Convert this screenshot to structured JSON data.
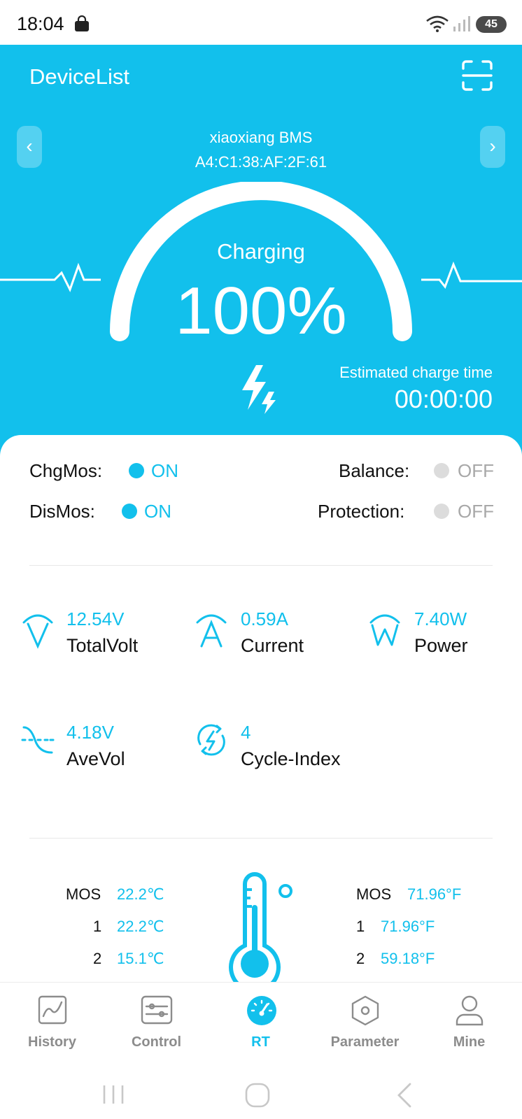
{
  "status_bar": {
    "time": "18:04",
    "battery": "45"
  },
  "header": {
    "title": "DeviceList",
    "prev_label": "‹",
    "next_label": "›",
    "device_name": "xiaoxiang BMS",
    "device_mac": "A4:C1:38:AF:2F:61",
    "state": "Charging",
    "percent": "100%",
    "percent_value": 100,
    "est_label": "Estimated charge time",
    "est_value": "00:00:00"
  },
  "status": {
    "chg_mos": {
      "label": "ChgMos:",
      "value": "ON"
    },
    "dis_mos": {
      "label": "DisMos:",
      "value": "ON"
    },
    "balance": {
      "label": "Balance:",
      "value": "OFF"
    },
    "protection": {
      "label": "Protection:",
      "value": "OFF"
    }
  },
  "metrics": {
    "total_volt": {
      "value": "12.54V",
      "label": "TotalVolt"
    },
    "current": {
      "value": "0.59A",
      "label": "Current"
    },
    "power": {
      "value": "7.40W",
      "label": "Power"
    },
    "ave_vol": {
      "value": "4.18V",
      "label": "AveVol"
    },
    "cycle_index": {
      "value": "4",
      "label": "Cycle-Index"
    }
  },
  "temps": {
    "celsius": [
      {
        "label": "MOS",
        "value": "22.2℃"
      },
      {
        "label": "1",
        "value": "22.2℃"
      },
      {
        "label": "2",
        "value": "15.1℃"
      }
    ],
    "fahrenheit": [
      {
        "label": "MOS",
        "value": "71.96°F"
      },
      {
        "label": "1",
        "value": "71.96°F"
      },
      {
        "label": "2",
        "value": "59.18°F"
      }
    ]
  },
  "nav": {
    "tabs": [
      {
        "label": "History",
        "icon": "history-chart-icon"
      },
      {
        "label": "Control",
        "icon": "control-sliders-icon"
      },
      {
        "label": "RT",
        "icon": "gauge-icon",
        "active": true
      },
      {
        "label": "Parameter",
        "icon": "hexagon-nut-icon"
      },
      {
        "label": "Mine",
        "icon": "person-icon"
      }
    ]
  },
  "colors": {
    "accent": "#12c0ec",
    "off": "#dcdcdc",
    "tab_inactive": "#8c8c8c"
  }
}
